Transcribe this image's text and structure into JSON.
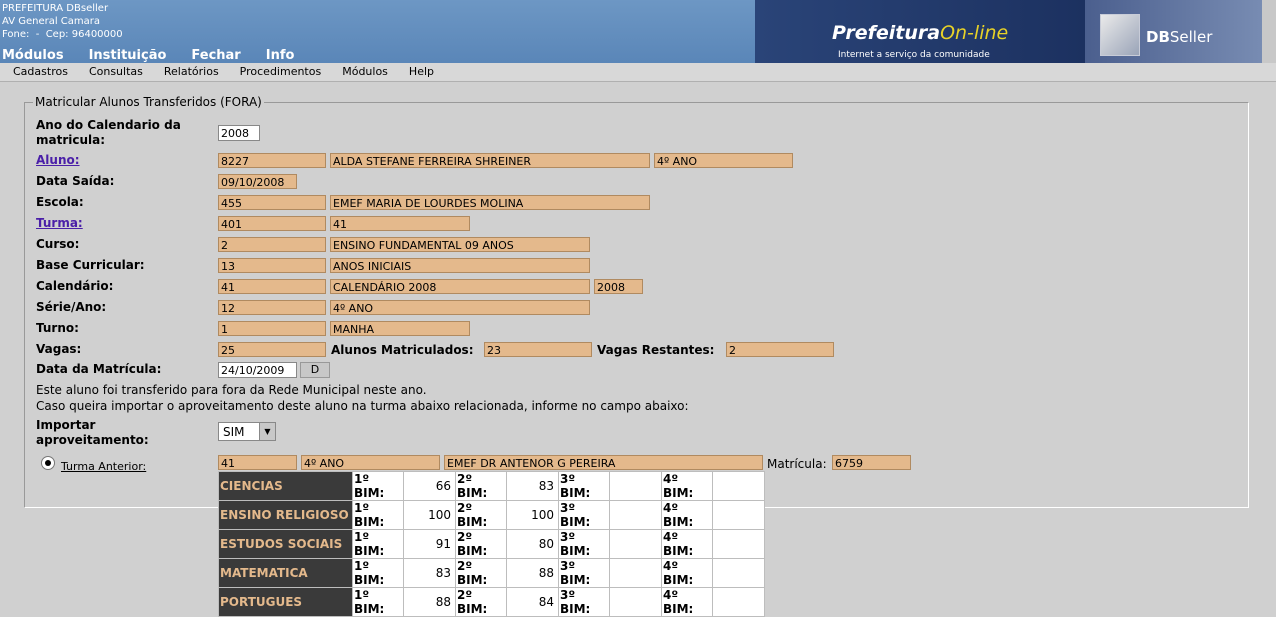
{
  "header": {
    "org_lines": "PREFEITURA DBseller\nAV General Camara\nFone:  -  Cep: 96400000",
    "top_menu": [
      "Módulos",
      "Instituição",
      "Fechar",
      "Info"
    ],
    "logo_prefeitura": "Prefeitura",
    "logo_online": "On-line",
    "logo_subtitle": "Internet a serviço da comunidade",
    "logo_db_bold": "DB",
    "logo_db_rest": "Seller"
  },
  "submenu": [
    "Cadastros",
    "Consultas",
    "Relatórios",
    "Procedimentos",
    "Módulos",
    "Help"
  ],
  "form": {
    "legend": "Matricular Alunos Transferidos (FORA)",
    "ano_label": "Ano do Calendario da matricula:",
    "ano_value": "2008",
    "aluno_label": "Aluno:",
    "aluno_code": "8227",
    "aluno_name": "ALDA STEFANE FERREIRA SHREINER",
    "aluno_serie": "4º ANO",
    "saida_label": "Data Saída:",
    "saida_value": "09/10/2008",
    "escola_label": "Escola:",
    "escola_code": "455",
    "escola_name": "EMEF MARIA DE LOURDES MOLINA",
    "turma_label": "Turma:",
    "turma_code": "401",
    "turma_name": "41",
    "curso_label": "Curso:",
    "curso_code": "2",
    "curso_name": "ENSINO FUNDAMENTAL 09 ANOS",
    "base_label": "Base Curricular:",
    "base_code": "13",
    "base_name": "ANOS INICIAIS",
    "cal_label": "Calendário:",
    "cal_code": "41",
    "cal_name": "CALENDÁRIO 2008",
    "cal_year": "2008",
    "serie_label": "Série/Ano:",
    "serie_code": "12",
    "serie_name": "4º ANO",
    "turno_label": "Turno:",
    "turno_code": "1",
    "turno_name": "MANHA",
    "vagas_label": "Vagas:",
    "vagas_value": "25",
    "matric_label": "Alunos Matriculados:",
    "matric_value": "23",
    "restantes_label": "Vagas Restantes:",
    "restantes_value": "2",
    "data_label": "Data da Matrícula:",
    "data_value": "24/10/2009",
    "data_button": "D",
    "msg1": "Este aluno foi transferido para fora da Rede Municipal neste ano.",
    "msg2": "Caso queira importar o aproveitamento deste aluno na turma abaixo relacionada, informe no campo abaixo:",
    "importar_label": "Importar aproveitamento:",
    "importar_value": "SIM",
    "anterior_label": "Turma Anterior:",
    "anterior_code": "41",
    "anterior_serie": "4º ANO",
    "anterior_escola": "EMEF DR ANTENOR G PEREIRA",
    "matricula_label": "Matrícula:",
    "matricula_value": "6759"
  },
  "grades": [
    {
      "subject": "CIENCIAS",
      "b1": "66",
      "b2": "83",
      "b3": "",
      "b4": ""
    },
    {
      "subject": "ENSINO RELIGIOSO",
      "b1": "100",
      "b2": "100",
      "b3": "",
      "b4": ""
    },
    {
      "subject": "ESTUDOS SOCIAIS",
      "b1": "91",
      "b2": "80",
      "b3": "",
      "b4": ""
    },
    {
      "subject": "MATEMATICA",
      "b1": "83",
      "b2": "88",
      "b3": "",
      "b4": ""
    },
    {
      "subject": "PORTUGUES",
      "b1": "88",
      "b2": "84",
      "b3": "",
      "b4": ""
    }
  ],
  "bim_labels": [
    "1º BIM:",
    "2º BIM:",
    "3º BIM:",
    "4º BIM:"
  ]
}
